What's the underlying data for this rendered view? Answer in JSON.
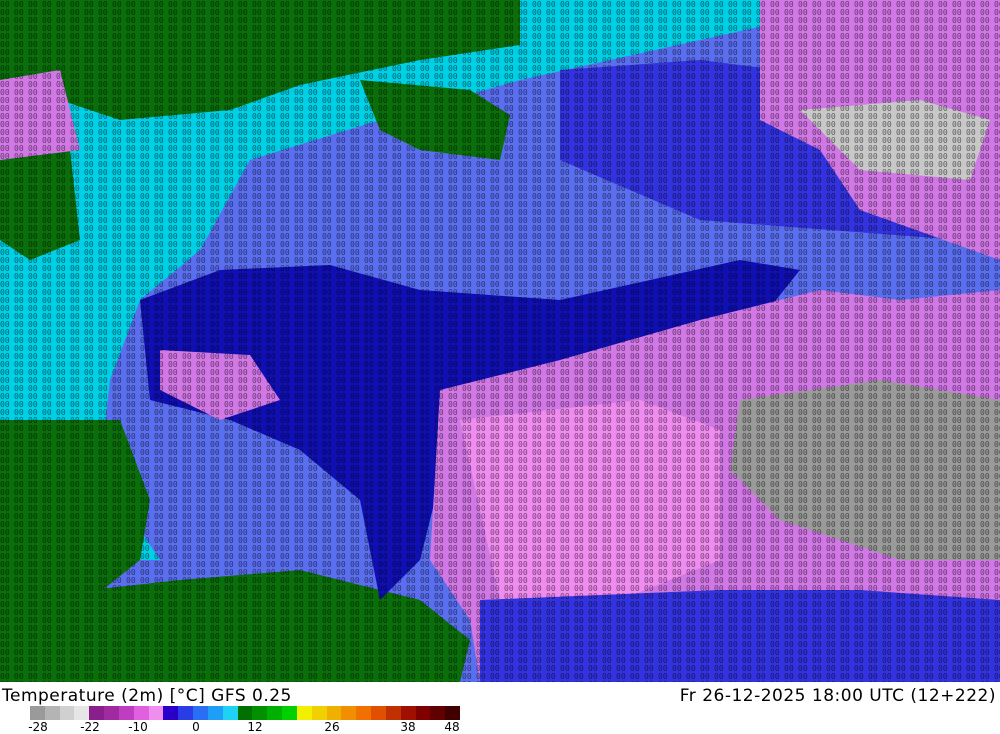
{
  "title": {
    "left": "Temperature (2m) [°C] GFS 0.25",
    "right": "Fr 26-12-2025 18:00 UTC (12+222)"
  },
  "legend": {
    "tick_labels": [
      "-28",
      "-22",
      "-10",
      "0",
      "12",
      "26",
      "38",
      "48"
    ],
    "colors": [
      "#9a9a9a",
      "#b4b4b4",
      "#d0d0d0",
      "#e6e6e6",
      "#8a1e8a",
      "#a02aa0",
      "#c03cc0",
      "#e060e0",
      "#f08ef0",
      "#2a00c8",
      "#2a3ce6",
      "#2a6ef6",
      "#1e9ef6",
      "#1ed2f6",
      "#007000",
      "#009000",
      "#00b000",
      "#00d000",
      "#f0f000",
      "#f0d000",
      "#f0b000",
      "#f09000",
      "#f07000",
      "#e05000",
      "#c03000",
      "#a01000",
      "#800000",
      "#600000",
      "#400000"
    ]
  },
  "map": {
    "palette": {
      "land": "#0a6e0a",
      "sea_cyan": "#00d0e6",
      "cold_light": "#5a6ef0",
      "cold_mid": "#3232e0",
      "cold_deep": "#0f0fb4",
      "frost": "#d278e6",
      "frost_light": "#f08cf0",
      "grey": "#9a9a9a",
      "grey_light": "#c8c8c8"
    }
  }
}
